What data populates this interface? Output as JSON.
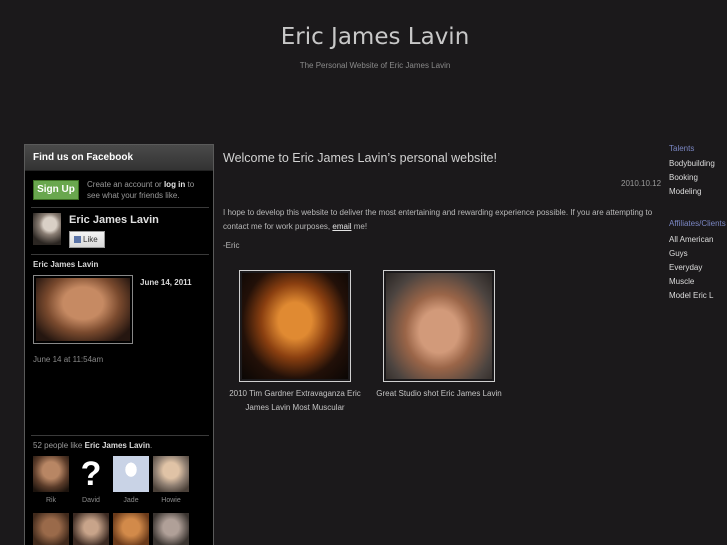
{
  "site": {
    "title": "Eric James Lavin",
    "tagline": "The Personal Website of Eric James Lavin"
  },
  "facebook": {
    "header": "Find us on Facebook",
    "signup_label": "Sign Up",
    "create_prefix": "Create an account or",
    "login_label": "log in",
    "create_suffix": "to see what your friends like.",
    "page_name": "Eric James Lavin",
    "like_label": "Like",
    "post_author": "Eric James Lavin",
    "post_date": "June 14, 2011",
    "post_time": "June 14 at 11:54am",
    "likes_prefix": "52 people like",
    "likes_page": "Eric James Lavin",
    "likes_suffix": ".",
    "fans": [
      {
        "name": "Rik"
      },
      {
        "name": "David"
      },
      {
        "name": "Jade"
      },
      {
        "name": "Howie"
      }
    ]
  },
  "post": {
    "title": "Welcome to Eric James Lavin’s personal website!",
    "date": "2010.10.12",
    "body_before": "I hope to develop this website to deliver the most entertaining and rewarding experience possible.  If you are attempting to contact me for work purposes,",
    "email_label": "email",
    "body_after": "me!",
    "signoff": "-Eric",
    "images": [
      {
        "caption_line1": "2010 Tim Gardner Extravaganza Eric",
        "caption_line2": "James Lavin Most Muscular"
      },
      {
        "caption_line1": "Great Studio shot Eric James Lavin",
        "caption_line2": ""
      }
    ]
  },
  "sidebar": {
    "talents_heading": "Talents",
    "talents": [
      "Bodybuilding",
      "Booking",
      "Modeling"
    ],
    "affiliates_heading": "Affiliates/Clients",
    "affiliates": [
      "All American",
      "Guys",
      "Everyday",
      "Muscle",
      "Model Eric L"
    ]
  },
  "colors": {
    "background": "#1b191b",
    "link_heading": "#7a86c2",
    "signup_green": "#69a74e"
  }
}
